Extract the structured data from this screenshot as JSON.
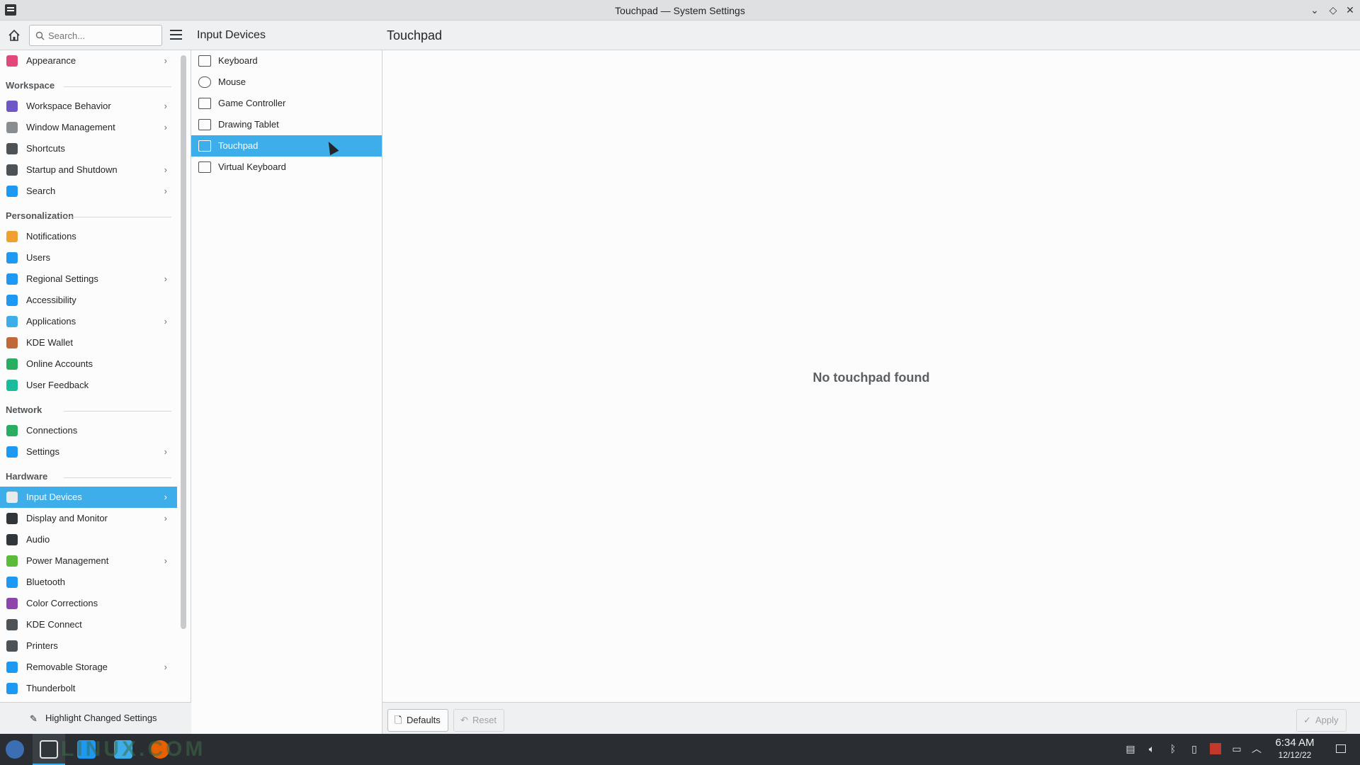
{
  "window": {
    "title": "Touchpad — System Settings",
    "buttons": [
      "minimize",
      "maximize",
      "close"
    ]
  },
  "search": {
    "placeholder": "Search..."
  },
  "sidebar": {
    "items": [
      {
        "type": "item",
        "label": "Appearance",
        "icon": "appearance-icon",
        "color": "#e0497a",
        "chevron": true
      },
      {
        "type": "header",
        "label": "Workspace"
      },
      {
        "type": "item",
        "label": "Workspace Behavior",
        "icon": "workspace-icon",
        "color": "#6f55c8",
        "chevron": true
      },
      {
        "type": "item",
        "label": "Window Management",
        "icon": "window-icon",
        "color": "#8a8d90",
        "chevron": true
      },
      {
        "type": "item",
        "label": "Shortcuts",
        "icon": "keyboard-icon",
        "color": "#4d5257",
        "chevron": false
      },
      {
        "type": "item",
        "label": "Startup and Shutdown",
        "icon": "startup-icon",
        "color": "#4d5257",
        "chevron": true
      },
      {
        "type": "item",
        "label": "Search",
        "icon": "search-icon",
        "color": "#1d99f3",
        "chevron": true
      },
      {
        "type": "header",
        "label": "Personalization"
      },
      {
        "type": "item",
        "label": "Notifications",
        "icon": "bell-icon",
        "color": "#f0a030",
        "chevron": false
      },
      {
        "type": "item",
        "label": "Users",
        "icon": "users-icon",
        "color": "#1d99f3",
        "chevron": false
      },
      {
        "type": "item",
        "label": "Regional Settings",
        "icon": "regional-icon",
        "color": "#1d99f3",
        "chevron": true
      },
      {
        "type": "item",
        "label": "Accessibility",
        "icon": "accessibility-icon",
        "color": "#1d99f3",
        "chevron": false
      },
      {
        "type": "item",
        "label": "Applications",
        "icon": "applications-icon",
        "color": "#3daee9",
        "chevron": true
      },
      {
        "type": "item",
        "label": "KDE Wallet",
        "icon": "wallet-icon",
        "color": "#c0683a",
        "chevron": false
      },
      {
        "type": "item",
        "label": "Online Accounts",
        "icon": "online-accounts-icon",
        "color": "#27ae60",
        "chevron": false
      },
      {
        "type": "item",
        "label": "User Feedback",
        "icon": "feedback-icon",
        "color": "#1abc9c",
        "chevron": false
      },
      {
        "type": "header",
        "label": "Network"
      },
      {
        "type": "item",
        "label": "Connections",
        "icon": "globe-icon",
        "color": "#27ae60",
        "chevron": false
      },
      {
        "type": "item",
        "label": "Settings",
        "icon": "network-settings-icon",
        "color": "#1d99f3",
        "chevron": true
      },
      {
        "type": "header",
        "label": "Hardware"
      },
      {
        "type": "item",
        "label": "Input Devices",
        "icon": "mouse-icon",
        "color": "#e8eaec",
        "chevron": true,
        "selected": true
      },
      {
        "type": "item",
        "label": "Display and Monitor",
        "icon": "monitor-icon",
        "color": "#31363b",
        "chevron": true
      },
      {
        "type": "item",
        "label": "Audio",
        "icon": "speaker-icon",
        "color": "#31363b",
        "chevron": false
      },
      {
        "type": "item",
        "label": "Power Management",
        "icon": "power-icon",
        "color": "#5dbb3a",
        "chevron": true
      },
      {
        "type": "item",
        "label": "Bluetooth",
        "icon": "bluetooth-icon",
        "color": "#1d99f3",
        "chevron": false
      },
      {
        "type": "item",
        "label": "Color Corrections",
        "icon": "color-icon",
        "color": "#8e44ad",
        "chevron": false
      },
      {
        "type": "item",
        "label": "KDE Connect",
        "icon": "phone-icon",
        "color": "#4d5257",
        "chevron": false
      },
      {
        "type": "item",
        "label": "Printers",
        "icon": "printer-icon",
        "color": "#4d5257",
        "chevron": false
      },
      {
        "type": "item",
        "label": "Removable Storage",
        "icon": "usb-icon",
        "color": "#1d99f3",
        "chevron": true
      },
      {
        "type": "item",
        "label": "Thunderbolt",
        "icon": "thunderbolt-icon",
        "color": "#1d99f3",
        "chevron": false
      }
    ],
    "highlight_label": "Highlight Changed Settings"
  },
  "subpanel": {
    "title": "Input Devices",
    "items": [
      {
        "label": "Keyboard",
        "icon": "keyboard-icon"
      },
      {
        "label": "Mouse",
        "icon": "mouse-icon"
      },
      {
        "label": "Game Controller",
        "icon": "gamepad-icon"
      },
      {
        "label": "Drawing Tablet",
        "icon": "tablet-icon"
      },
      {
        "label": "Touchpad",
        "icon": "touchpad-icon",
        "selected": true
      },
      {
        "label": "Virtual Keyboard",
        "icon": "virtual-keyboard-icon"
      }
    ]
  },
  "main": {
    "title": "Touchpad",
    "message": "No touchpad found",
    "defaults_label": "Defaults",
    "reset_label": "Reset",
    "apply_label": "Apply"
  },
  "taskbar": {
    "watermark": "LINUX.COM",
    "time": "6:34 AM",
    "date": "12/12/22"
  },
  "colors": {
    "accent": "#3daee9",
    "panel": "#2a2e32"
  }
}
